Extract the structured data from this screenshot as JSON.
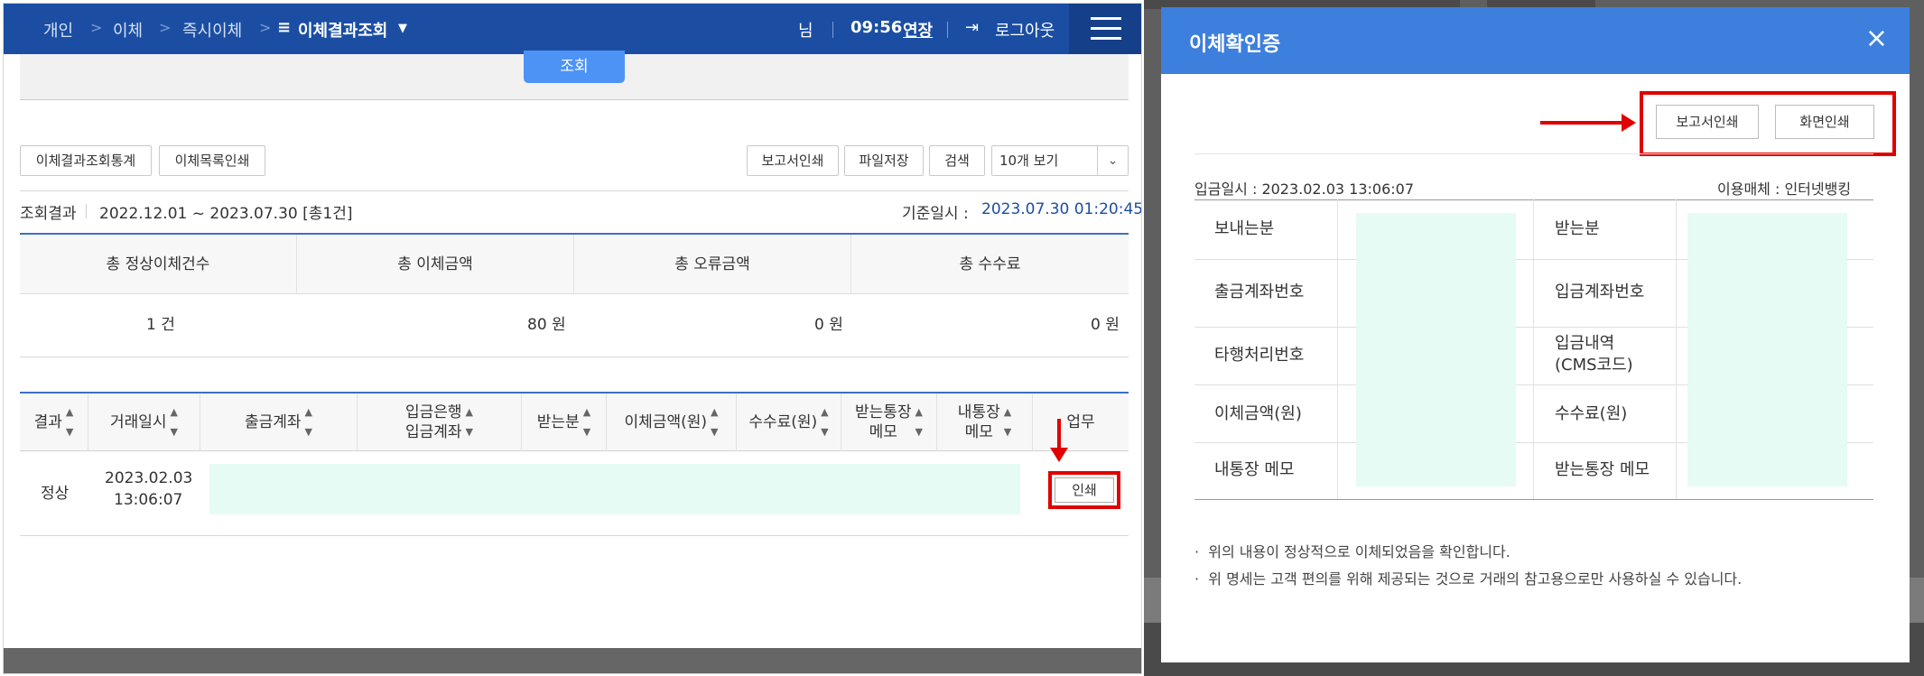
{
  "topbar": {
    "breadcrumbs": [
      "개인",
      "이체",
      "즉시이체"
    ],
    "current_page": "이체결과조회",
    "user_suffix": "님",
    "time": "09:56",
    "extend_label": "연장",
    "logout_label": "로그아웃"
  },
  "search": {
    "button_label": "조회"
  },
  "toolbar": {
    "stats_button": "이체결과조회통계",
    "list_print_button": "이체목록인쇄",
    "report_print_button": "보고서인쇄",
    "file_save_button": "파일저장",
    "find_button": "검색",
    "page_size_select": "10개 보기"
  },
  "result": {
    "label": "조회결과",
    "range": "2022.12.01 ~ 2023.07.30 [총1건]",
    "base_label": "기준일시 :",
    "base_datetime": "2023.07.30 01:20:45"
  },
  "summary": {
    "headers": [
      "총 정상이체건수",
      "총 이체금액",
      "총 오류금액",
      "총 수수료"
    ],
    "values": [
      "1 건",
      "80 원",
      "0 원",
      "0 원"
    ]
  },
  "table": {
    "headers": {
      "result": "결과",
      "datetime": "거래일시",
      "from_account": "출금계좌",
      "to_bank_line1": "입금은행",
      "to_bank_line2": "입금계좌",
      "receiver": "받는분",
      "amount": "이체금액(원)",
      "fee": "수수료(원)",
      "recv_memo_line1": "받는통장",
      "recv_memo_line2": "메모",
      "my_memo_line1": "내통장",
      "my_memo_line2": "메모",
      "task": "업무"
    },
    "rows": [
      {
        "result": "정상",
        "date": "2023.02.03",
        "time": "13:06:07",
        "action": "인쇄"
      }
    ]
  },
  "modal": {
    "title": "이체확인증",
    "close_icon": "×",
    "report_print_button": "보고서인쇄",
    "screen_print_button": "화면인쇄",
    "deposit_datetime": "입금일시 : 2023.02.03 13:06:07",
    "channel": "이용매체 : 인터넷뱅킹",
    "fields_left": [
      "보내는분",
      "출금계좌번호",
      "타행처리번호",
      "이체금액(원)",
      "내통장 메모"
    ],
    "fields_right": [
      "받는분",
      "입금계좌번호",
      "입금내역",
      "(CMS코드)",
      "수수료(원)",
      "받는통장 메모"
    ],
    "notes": [
      "위의 내용이 정상적으로 이체되었음을 확인합니다.",
      "위 명세는 고객 편의를 위해 제공되는 것으로 거래의 참고용으로만 사용하실 수 있습니다."
    ]
  },
  "colors": {
    "topbar": "#1b4ea3",
    "modal_header": "#3d7fdc",
    "highlight": "#e00000",
    "mask": "#e6fbf3"
  }
}
